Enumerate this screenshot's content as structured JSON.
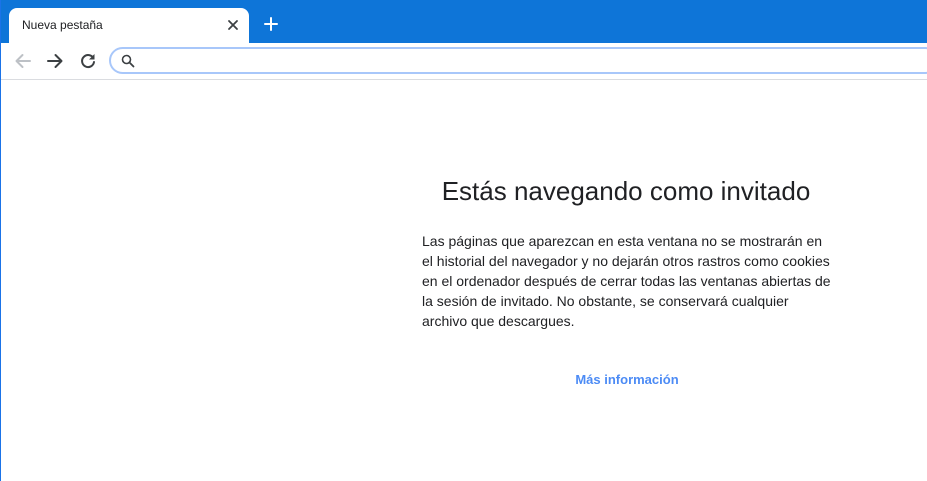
{
  "browser": {
    "tab": {
      "title": "Nueva pestaña",
      "close_icon": "close-icon"
    },
    "new_tab_icon": "plus-icon",
    "toolbar": {
      "back_icon": "arrow-left-icon",
      "forward_icon": "arrow-right-icon",
      "reload_icon": "reload-icon"
    },
    "omnibox": {
      "icon": "search-icon",
      "value": "",
      "placeholder": ""
    },
    "colors": {
      "tabstrip": "#0e75d8",
      "link": "#4c8bf5",
      "omnibox_border": "#a8c7fa"
    }
  },
  "page": {
    "title": "Estás navegando como invitado",
    "description": "Las páginas que aparezcan en esta ventana no se mostrarán en el historial del navegador y no dejarán otros rastros como cookies en el ordenador después de cerrar todas las ventanas abiertas de la sesión de invitado. No obstante, se conservará cualquier archivo que descargues.",
    "learn_more": "Más información"
  }
}
